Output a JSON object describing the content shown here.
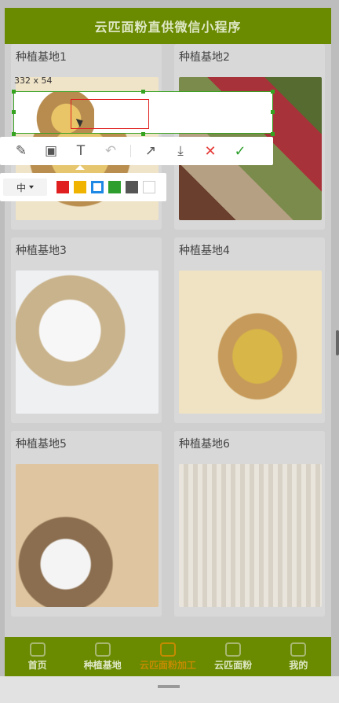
{
  "header": {
    "title": "云匹面粉直供微信小程序"
  },
  "bases": [
    {
      "title": "种植基地1"
    },
    {
      "title": "种植基地2"
    },
    {
      "title": "种植基地3"
    },
    {
      "title": "种植基地4"
    },
    {
      "title": "种植基地5"
    },
    {
      "title": "种植基地6"
    }
  ],
  "tabbar": {
    "items": [
      {
        "label": "首页",
        "icon": "home-icon"
      },
      {
        "label": "种植基地",
        "icon": "grid-icon"
      },
      {
        "label": "云匹面粉加工",
        "icon": "processing-icon",
        "active": true
      },
      {
        "label": "云匹面粉",
        "icon": "box-icon"
      },
      {
        "label": "我的",
        "icon": "user-icon"
      }
    ]
  },
  "screenshot_tool": {
    "selection_size": "332 x 54",
    "tools": [
      {
        "name": "pen",
        "glyph": "✎"
      },
      {
        "name": "mosaic",
        "glyph": "▣"
      },
      {
        "name": "text",
        "glyph": "T"
      },
      {
        "name": "undo",
        "glyph": "↶",
        "disabled": true
      },
      {
        "name": "share",
        "glyph": "↗"
      },
      {
        "name": "download",
        "glyph": "⤓"
      },
      {
        "name": "cancel",
        "glyph": "✕"
      },
      {
        "name": "confirm",
        "glyph": "✓"
      }
    ],
    "font_size": "中",
    "colors": [
      "#e02020",
      "#f0b400",
      "#1e88e5",
      "#2e9f2e",
      "#555555",
      "#ffffff"
    ],
    "selected_color_index": 2
  }
}
